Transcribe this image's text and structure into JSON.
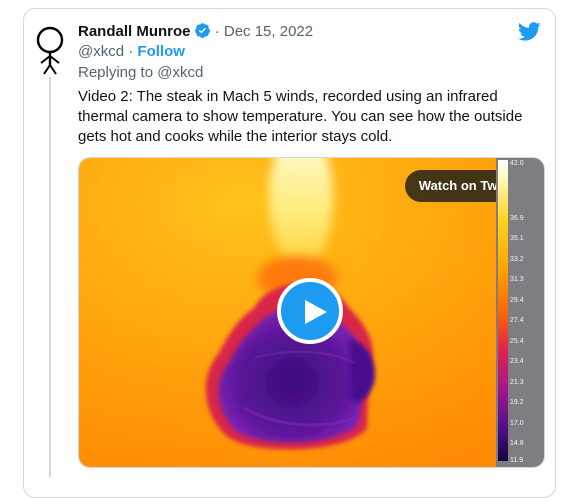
{
  "tweet": {
    "author_name": "Randall Munroe",
    "date_sep": " · ",
    "date": "Dec 15, 2022",
    "handle": "@xkcd",
    "handle_sep": " · ",
    "follow_label": "Follow",
    "replying_prefix": "Replying to ",
    "replying_to": "@xkcd",
    "text": "Video 2: The steak in Mach 5 winds, recorded using an infrared thermal camera to show temperature. You can see how the outside gets hot and cooks while the interior stays cold."
  },
  "media": {
    "watch_label": "Watch on Twitter",
    "temperature_scale": [
      "42.0",
      "36.9",
      "35.1",
      "33.2",
      "31.3",
      "29.4",
      "27.4",
      "25.4",
      "23.4",
      "21.3",
      "19.2",
      "17.0",
      "14.8",
      "11.9"
    ]
  },
  "colors": {
    "accent": "#1d9bf0",
    "text_primary": "#0f1419",
    "text_secondary": "#536471"
  },
  "icons": {
    "avatar": "stick-figure-avatar",
    "verified": "verified-badge-icon",
    "brand": "twitter-bird-icon",
    "play": "play-icon"
  }
}
